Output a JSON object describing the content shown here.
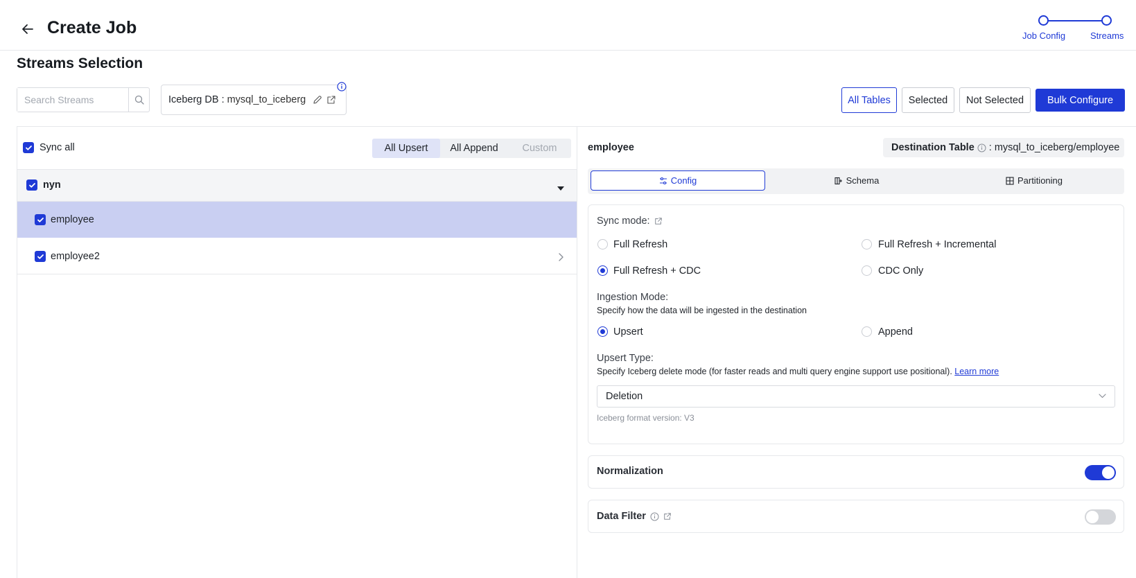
{
  "header": {
    "title": "Create Job",
    "steps": [
      {
        "label": "Job Config"
      },
      {
        "label": "Streams"
      }
    ]
  },
  "streams": {
    "section_title": "Streams Selection",
    "search_placeholder": "Search Streams",
    "destination": {
      "label": "Iceberg DB :",
      "value": "mysql_to_iceberg"
    },
    "filters": [
      "All Tables",
      "Selected",
      "Not Selected"
    ],
    "active_filter": "All Tables",
    "bulk_configure": "Bulk Configure",
    "sync_all_label": "Sync all",
    "sync_all_checked": true,
    "modes": [
      "All Upsert",
      "All Append",
      "Custom"
    ],
    "active_mode": "All Upsert",
    "group": {
      "name": "nyn",
      "checked": true,
      "expanded": true
    },
    "items": [
      {
        "name": "employee",
        "checked": true,
        "selected": true
      },
      {
        "name": "employee2",
        "checked": true,
        "selected": false
      }
    ]
  },
  "detail": {
    "stream_name": "employee",
    "destination_table_label": "Destination Table",
    "destination_table_sep": ":",
    "destination_table_value": "mysql_to_iceberg/employee",
    "tabs": [
      "Config",
      "Schema",
      "Partitioning"
    ],
    "active_tab": "Config",
    "sync_mode_label": "Sync mode:",
    "sync_modes": [
      "Full Refresh",
      "Full Refresh + Incremental",
      "Full Refresh + CDC",
      "CDC Only"
    ],
    "selected_sync_mode": "Full Refresh + CDC",
    "ingestion_label": "Ingestion Mode:",
    "ingestion_desc": "Specify how the data will be ingested in the destination",
    "ingestion_modes": [
      "Upsert",
      "Append"
    ],
    "selected_ingestion": "Upsert",
    "upsert_type_label": "Upsert Type:",
    "upsert_type_desc": "Specify Iceberg delete mode (for faster reads and multi query engine support use positional).",
    "learn_more": "Learn more",
    "upsert_type_value": "Deletion",
    "format_version": "Iceberg format version: V3",
    "normalization_label": "Normalization",
    "normalization_on": true,
    "data_filter_label": "Data Filter",
    "data_filter_on": false
  },
  "colors": {
    "accent": "#1f3ad6",
    "selected_row": "#c9cff2"
  }
}
